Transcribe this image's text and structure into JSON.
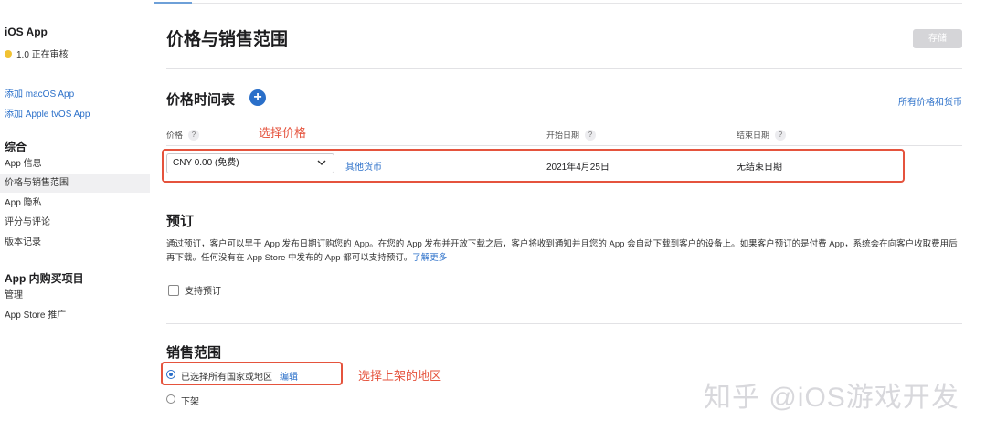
{
  "sidebar": {
    "app_name": "iOS App",
    "status": "1.0 正在审核",
    "links": [
      "添加 macOS App",
      "添加 Apple tvOS App"
    ],
    "general_heading": "综合",
    "general_items": [
      "App 信息",
      "价格与销售范围",
      "App 隐私",
      "评分与评论",
      "版本记录"
    ],
    "iap_heading": "App 内购买项目",
    "iap_items": [
      "管理",
      "App Store 推广"
    ]
  },
  "header": {
    "title": "价格与销售范围",
    "save_label": "存储"
  },
  "price_schedule": {
    "title": "价格时间表",
    "add_icon": "plus",
    "all_prices_link": "所有价格和货币",
    "columns": {
      "price": "价格",
      "start_date": "开始日期",
      "end_date": "结束日期"
    },
    "help_glyph": "?",
    "row": {
      "price_value": "CNY 0.00 (免费)",
      "other_currency": "其他货币",
      "start_date": "2021年4月25日",
      "end_date": "无结束日期"
    }
  },
  "preorder": {
    "title": "预订",
    "description": "通过预订，客户可以早于 App 发布日期订购您的 App。在您的 App 发布并开放下载之后，客户将收到通知并且您的 App 会自动下载到客户的设备上。如果客户预订的是付费 App，系统会在向客户收取费用后再下载。任何没有在 App Store 中发布的 App 都可以支持预订。",
    "learn_more": "了解更多",
    "checkbox_label": "支持预订"
  },
  "availability": {
    "title": "销售范围",
    "option_all": "已选择所有国家或地区",
    "edit_link": "编辑",
    "option_remove": "下架"
  },
  "annotations": {
    "select_price": "选择价格",
    "select_regions": "选择上架的地区"
  },
  "watermark": "知乎 @iOS游戏开发",
  "colors": {
    "link": "#2a6fc9",
    "annotation": "#e5533d",
    "status_dot": "#f1c232"
  }
}
